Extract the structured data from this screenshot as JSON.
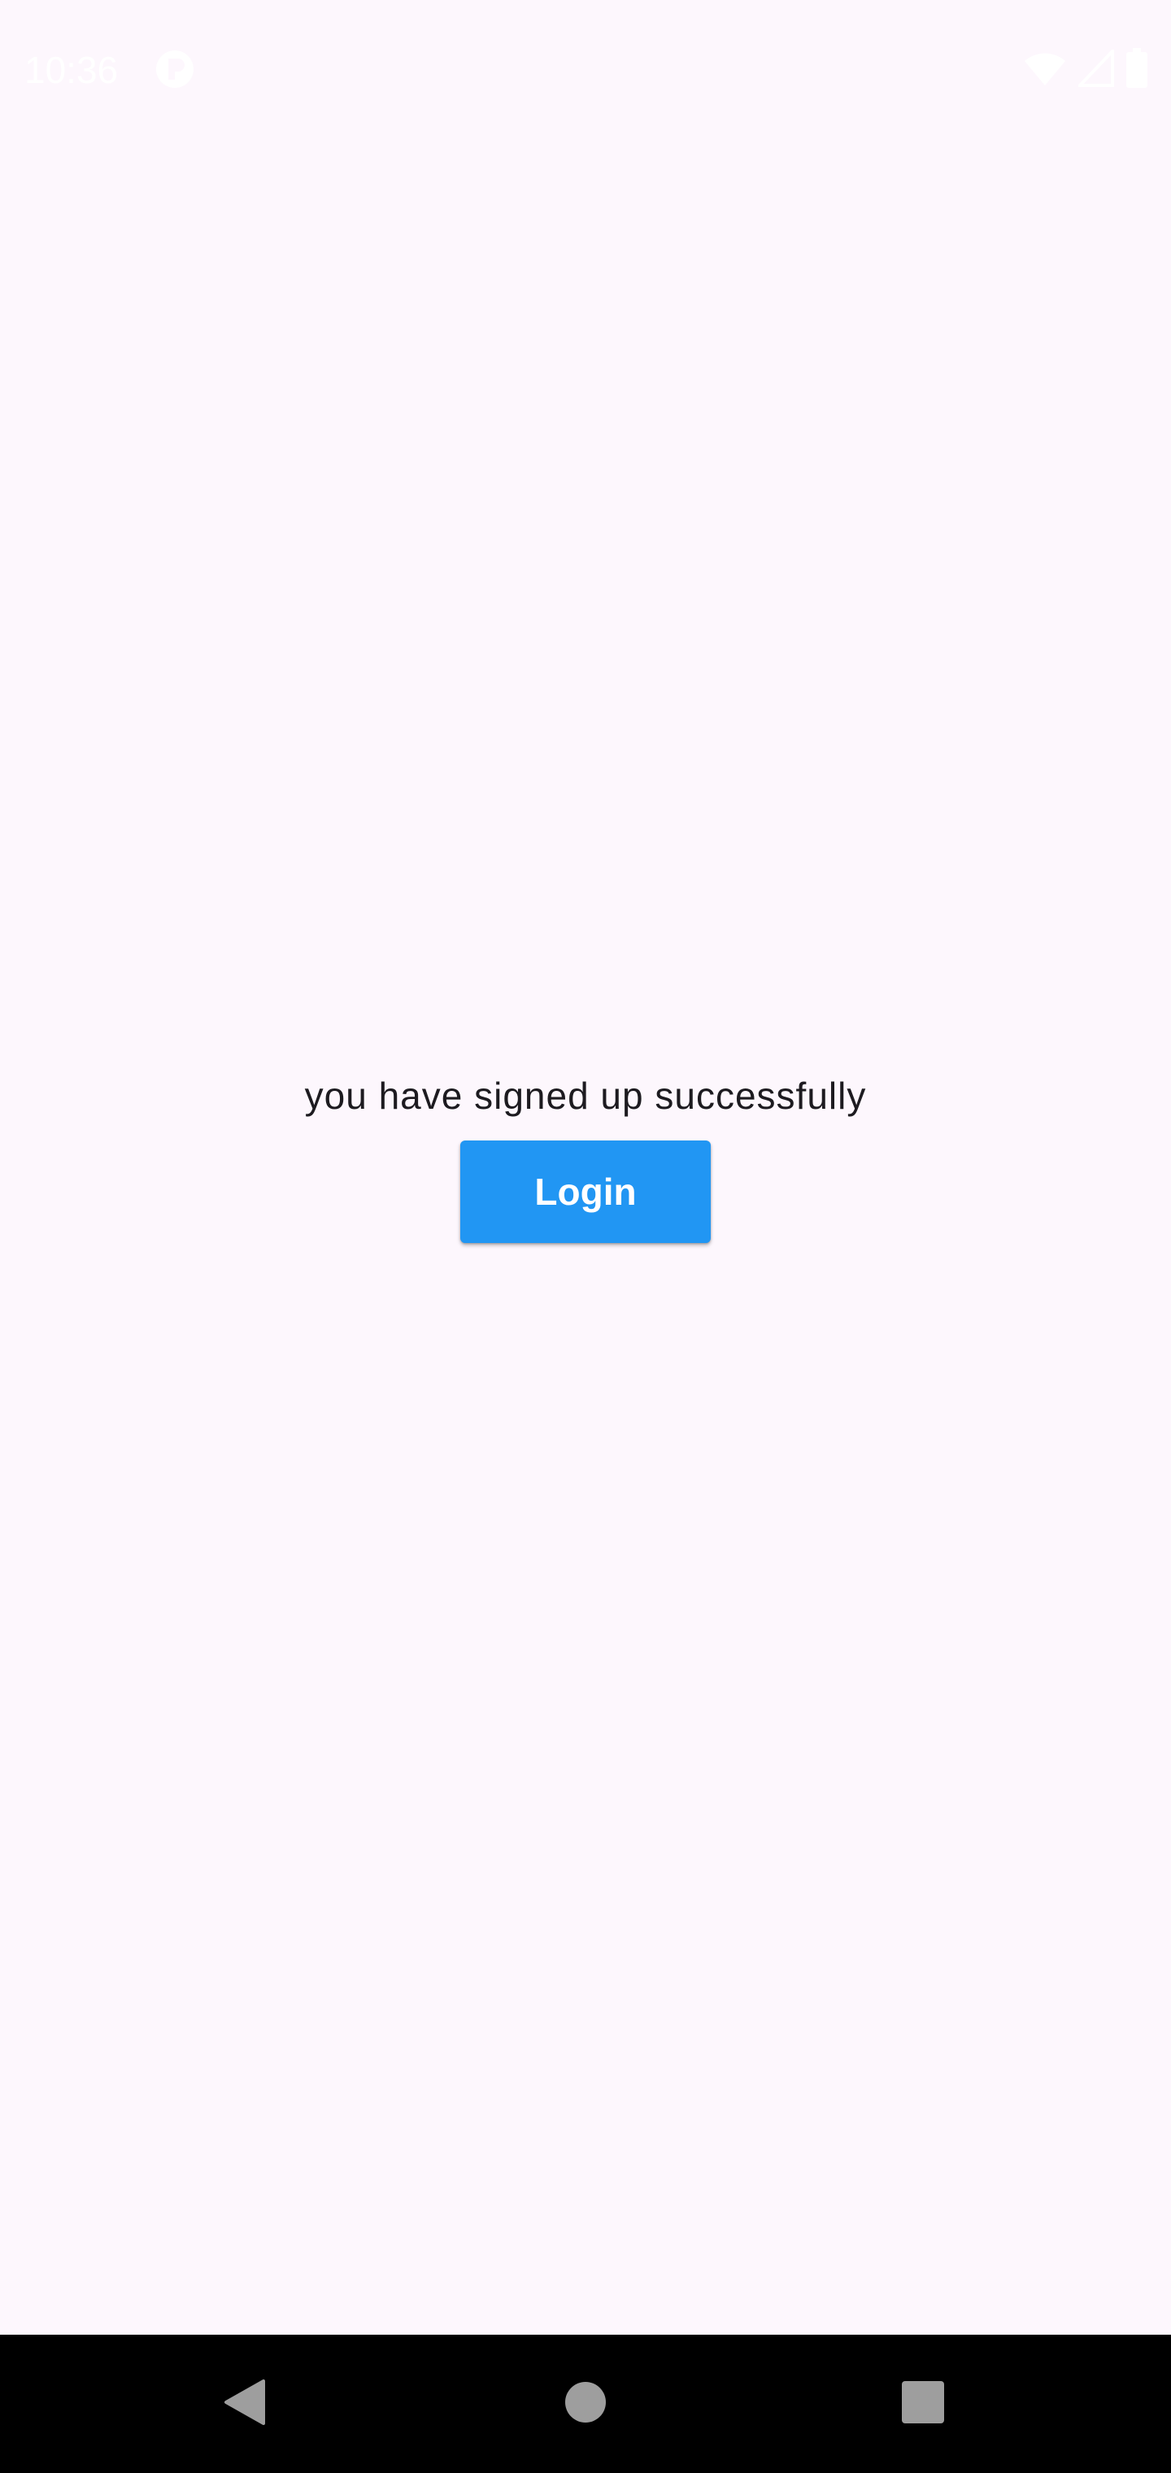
{
  "status_bar": {
    "time": "10:36",
    "icons": [
      "app-notification-icon",
      "wifi-icon",
      "signal-icon",
      "battery-icon"
    ]
  },
  "main": {
    "message": "you have signed up successfully",
    "login_button_label": "Login"
  },
  "nav_bar": {
    "buttons": [
      "back-icon",
      "home-icon",
      "recents-icon"
    ]
  },
  "colors": {
    "background": "#fdf7fd",
    "button": "#2196f3",
    "button_text": "#ffffff",
    "text": "#1d1b20",
    "nav_bar": "#000000",
    "nav_icons": "#9e9e9e"
  }
}
